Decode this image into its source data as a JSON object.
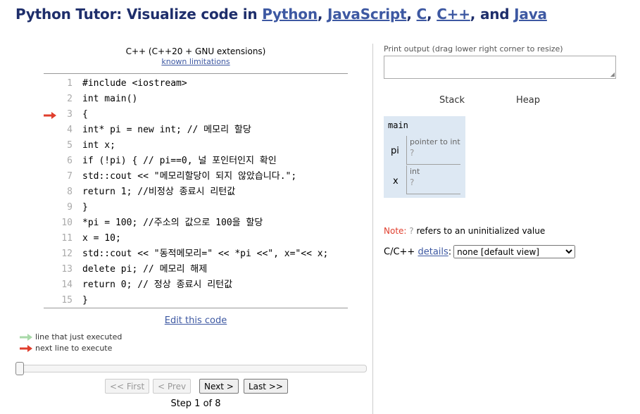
{
  "header": {
    "prefix": "Python Tutor: Visualize code in ",
    "langs": [
      "Python",
      "JavaScript",
      "C",
      "C++",
      "Java"
    ],
    "sep1": ", ",
    "sep2": ", ",
    "sep3": ", ",
    "sep4": ", and "
  },
  "editor": {
    "language_label": "C++ (C++20 + GNU extensions)",
    "limitations_link": "known limitations",
    "current_line": 3,
    "lines": [
      {
        "num": "1",
        "text": "#include <iostream>"
      },
      {
        "num": "2",
        "text": "int main()"
      },
      {
        "num": "3",
        "text": "{"
      },
      {
        "num": "4",
        "text": "int* pi = new int; // 메모리 할당"
      },
      {
        "num": "5",
        "text": "int x;"
      },
      {
        "num": "6",
        "text": "if (!pi) { // pi==0, 널 포인터인지 확인"
      },
      {
        "num": "7",
        "text": "std::cout << \"메모리할당이 되지 않았습니다.\";"
      },
      {
        "num": "8",
        "text": "return 1; //비정상 종료시 리턴값"
      },
      {
        "num": "9",
        "text": "}"
      },
      {
        "num": "10",
        "text": "*pi = 100; //주소의 값으로 100을 할당"
      },
      {
        "num": "11",
        "text": "x = 10;"
      },
      {
        "num": "12",
        "text": "std::cout << \"동적메모리=\" << *pi <<\", x=\"<< x;"
      },
      {
        "num": "13",
        "text": "delete pi; // 메모리 해제"
      },
      {
        "num": "14",
        "text": "return 0; // 정상 종료시 리턴값"
      },
      {
        "num": "15",
        "text": "}"
      }
    ],
    "edit_link": "Edit this code"
  },
  "legend": {
    "just_executed": "line that just executed",
    "next_line": "next line to execute"
  },
  "colors": {
    "just_executed_arrow": "#a8d9a8",
    "next_line_arrow": "#e03e2d",
    "frame_bg": "#dde8f3"
  },
  "navigation": {
    "first": "<< First",
    "prev": "< Prev",
    "next": "Next >",
    "last": "Last >>",
    "step_text": "Step 1 of 8",
    "progress": 0.0
  },
  "output": {
    "label": "Print output (drag lower right corner to resize)",
    "content": ""
  },
  "visualization": {
    "stack_header": "Stack",
    "heap_header": "Heap",
    "frame_name": "main",
    "vars": [
      {
        "name": "pi",
        "type": "pointer to int",
        "value": "?"
      },
      {
        "name": "x",
        "type": "int",
        "value": "?"
      }
    ]
  },
  "note": {
    "label": "Note:",
    "symbol": "?",
    "text": "refers to an uninitialized value"
  },
  "details": {
    "prefix": "C/C++",
    "link": "details",
    "suffix": ":",
    "selected": "none [default view]"
  }
}
